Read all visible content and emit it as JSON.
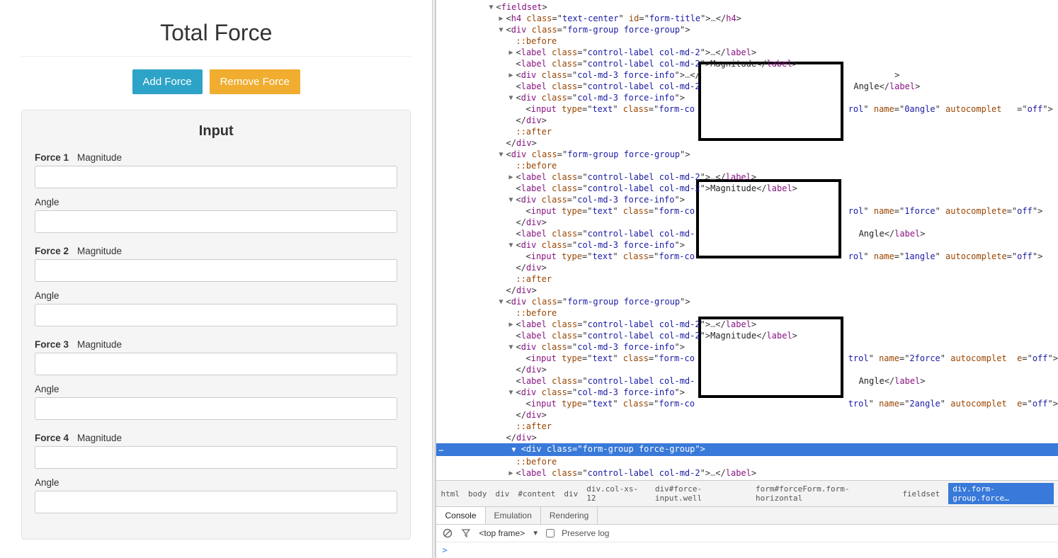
{
  "page": {
    "title": "Total Force",
    "add_button": "Add Force",
    "remove_button": "Remove Force",
    "input_heading": "Input"
  },
  "forces": [
    {
      "name": "Force 1",
      "mag_label": "Magnitude",
      "angle_label": "Angle"
    },
    {
      "name": "Force 2",
      "mag_label": "Magnitude",
      "angle_label": "Angle"
    },
    {
      "name": "Force 3",
      "mag_label": "Magnitude",
      "angle_label": "Angle"
    },
    {
      "name": "Force 4",
      "mag_label": "Magnitude",
      "angle_label": "Angle"
    }
  ],
  "devtools": {
    "tokens": {
      "fieldset": "fieldset",
      "h4": "h4",
      "div": "div",
      "label": "label",
      "input": "input",
      "close_h4": "h4",
      "close_div": "div",
      "close_label": "label",
      "class": "class",
      "id": "id",
      "type": "type",
      "name": "name",
      "autocomplete": "autocomplete",
      "before": "::before",
      "after": "::after",
      "text_center": "text-center",
      "form_title": "form-title",
      "form_group": "form-group force-group",
      "control_label": "control-label col-md-2",
      "col_md3": "col-md-3 force-info",
      "text": "text",
      "form_control": "form-control",
      "form_co_trunc": "form-co",
      "col_md_trunc": "control-label col-md-",
      "autocomplet_trunc": "autocomplet",
      "off": "off",
      "magnitude": "Magnitude",
      "angle": "Angle",
      "n0angle": "0angle",
      "n1force": "1force",
      "n1angle": "1angle",
      "n2force": "2force",
      "n2angle": "2angle",
      "rol": "rol",
      "trol": "trol",
      "two": "2",
      "e_eq": "e"
    },
    "crumbs": [
      "html",
      "body",
      "div",
      "#content",
      "div",
      "div.col-xs-12",
      "div#force-input.well",
      "form#forceForm.form-horizontal",
      "fieldset",
      "div.form-group.force…"
    ],
    "tabs": [
      "Console",
      "Emulation",
      "Rendering"
    ],
    "console": {
      "frame": "<top frame>",
      "preserve": "Preserve log",
      "prompt": ">"
    }
  }
}
